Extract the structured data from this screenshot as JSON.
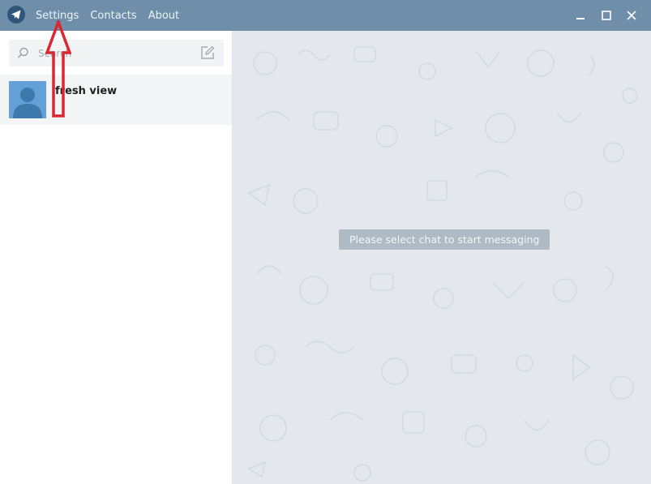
{
  "menu": {
    "items": [
      {
        "label": "Settings"
      },
      {
        "label": "Contacts"
      },
      {
        "label": "About"
      }
    ]
  },
  "search": {
    "placeholder": "Search"
  },
  "chats": [
    {
      "name": "fresh view"
    }
  ],
  "main": {
    "empty_message": "Please select chat to start messaging"
  },
  "colors": {
    "titlebar": "#6f8ea9",
    "logo_bg": "#2f5679",
    "chat_bg": "#e4e8ec",
    "avatar": "#63a0d7",
    "annotation_arrow": "#d9282f"
  },
  "icons": [
    "telegram-logo-icon",
    "search-icon",
    "compose-icon",
    "minimize-icon",
    "maximize-icon",
    "close-icon",
    "default-avatar-icon"
  ]
}
